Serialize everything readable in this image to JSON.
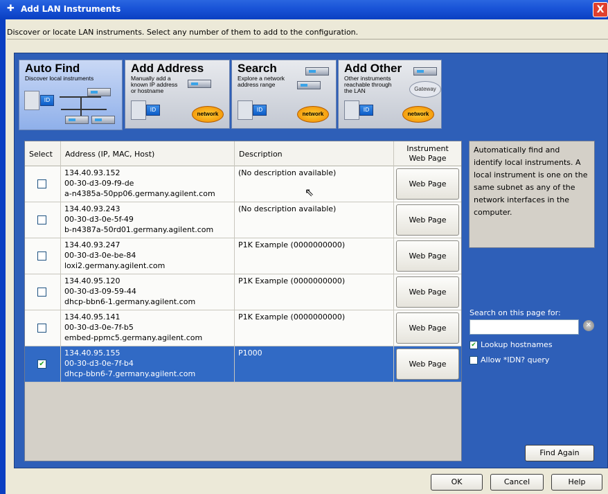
{
  "window": {
    "title": "Add LAN Instruments",
    "close_label": "X"
  },
  "instructions": "Discover or locate LAN instruments. Select any number of them to add to the configuration.",
  "tabs": [
    {
      "title": "Auto Find",
      "desc": "Discover local instruments",
      "active": true
    },
    {
      "title": "Add Address",
      "desc": "Manually add a known IP address or hostname",
      "active": false
    },
    {
      "title": "Search",
      "desc": "Explore a network address range",
      "active": false
    },
    {
      "title": "Add Other",
      "desc": "Other instruments reachable through the LAN",
      "active": false
    }
  ],
  "graphics": {
    "network_label": "network",
    "gateway_label": "Gateway",
    "id_label": "ID"
  },
  "table": {
    "headers": {
      "select": "Select",
      "address": "Address (IP, MAC, Host)",
      "description": "Description",
      "web": "Instrument\nWeb Page"
    },
    "rows": [
      {
        "ip": "134.40.93.152",
        "mac": "00-30-d3-09-f9-de",
        "host": "a-n4385a-50pp06.germany.agilent.com",
        "desc": "(No description available)",
        "web": "Web Page",
        "checked": false,
        "selected": false
      },
      {
        "ip": "134.40.93.243",
        "mac": "00-30-d3-0e-5f-49",
        "host": "b-n4387a-50rd01.germany.agilent.com",
        "desc": "(No description available)",
        "web": "Web Page",
        "checked": false,
        "selected": false
      },
      {
        "ip": "134.40.93.247",
        "mac": "00-30-d3-0e-be-84",
        "host": "loxi2.germany.agilent.com",
        "desc": "P1K Example (0000000000)",
        "web": "Web Page",
        "checked": false,
        "selected": false
      },
      {
        "ip": "134.40.95.120",
        "mac": "00-30-d3-09-59-44",
        "host": "dhcp-bbn6-1.germany.agilent.com",
        "desc": "P1K Example (0000000000)",
        "web": "Web Page",
        "checked": false,
        "selected": false
      },
      {
        "ip": "134.40.95.141",
        "mac": "00-30-d3-0e-7f-b5",
        "host": "embed-ppmc5.germany.agilent.com",
        "desc": "P1K Example (0000000000)",
        "web": "Web Page",
        "checked": false,
        "selected": false
      },
      {
        "ip": "134.40.95.155",
        "mac": "00-30-d3-0e-7f-b4",
        "host": "dhcp-bbn6-7.germany.agilent.com",
        "desc": "P1000",
        "web": "Web Page",
        "checked": true,
        "selected": true
      }
    ]
  },
  "help_text": "Automatically find and identify local instruments. A local instrument is one on the same subnet as any of the network interfaces in the computer.",
  "search": {
    "label": "Search on this page for:",
    "value": "",
    "placeholder": ""
  },
  "options": {
    "lookup_hostnames": {
      "label": "Lookup hostnames",
      "checked": true
    },
    "allow_idn": {
      "label": "Allow *IDN? query",
      "checked": false
    }
  },
  "buttons": {
    "find_again": "Find Again",
    "ok": "OK",
    "cancel": "Cancel",
    "help": "Help"
  },
  "colors": {
    "selection": "#316ac5",
    "panel": "#2e5fb8",
    "titlebar": "#1a55d8"
  }
}
